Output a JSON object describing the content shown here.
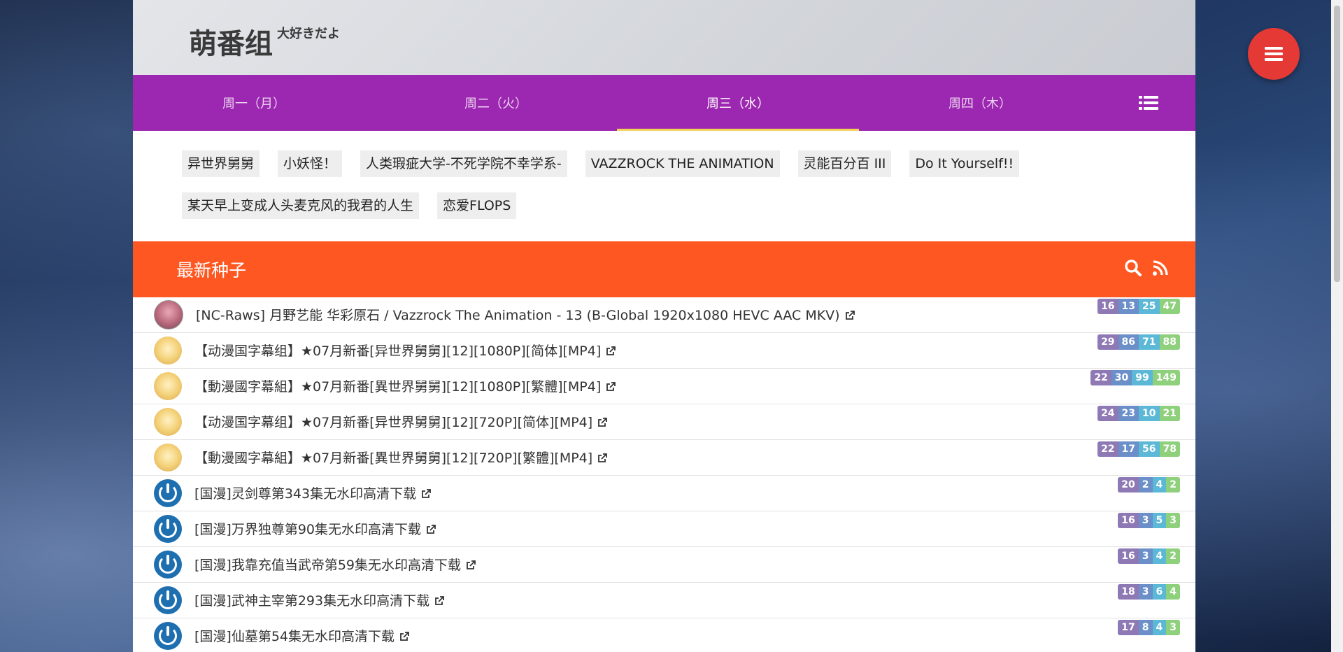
{
  "site": {
    "logo_main": "萌番组",
    "logo_sub": "大好きだよ"
  },
  "days": [
    {
      "label": "周一（月）",
      "active": false
    },
    {
      "label": "周二（火）",
      "active": false
    },
    {
      "label": "周三（水）",
      "active": true
    },
    {
      "label": "周四（木）",
      "active": false
    }
  ],
  "tags": [
    "异世界舅舅",
    "小妖怪！",
    "人类瑕疵大学-不死学院不幸学系-",
    "VAZZROCK THE ANIMATION",
    "灵能百分百 III",
    "Do It Yourself!!",
    "某天早上变成人头麦克风的我君的人生",
    "恋爱FLOPS"
  ],
  "seeds": {
    "title": "最新种子",
    "icons": [
      "search-icon",
      "rss-icon"
    ]
  },
  "torrents": [
    {
      "avatar": "nc",
      "title": "[NC-Raws] 月野艺能 华彩原石 / Vazzrock The Animation - 13 (B-Global 1920x1080 HEVC AAC MKV)",
      "stats": [
        "16",
        "13",
        "25",
        "47"
      ]
    },
    {
      "avatar": "dm",
      "title": "【动漫国字幕组】★07月新番[异世界舅舅][12][1080P][简体][MP4]",
      "stats": [
        "29",
        "86",
        "71",
        "88"
      ]
    },
    {
      "avatar": "dm",
      "title": "【動漫國字幕組】★07月新番[異世界舅舅][12][1080P][繁體][MP4]",
      "stats": [
        "22",
        "30",
        "99",
        "149"
      ]
    },
    {
      "avatar": "dm",
      "title": "【动漫国字幕组】★07月新番[异世界舅舅][12][720P][简体][MP4]",
      "stats": [
        "24",
        "23",
        "10",
        "21"
      ]
    },
    {
      "avatar": "dm",
      "title": "【動漫國字幕組】★07月新番[異世界舅舅][12][720P][繁體][MP4]",
      "stats": [
        "22",
        "17",
        "56",
        "78"
      ]
    },
    {
      "avatar": "gm",
      "title": "[国漫]灵剑尊第343集无水印高清下载",
      "stats": [
        "20",
        "2",
        "4",
        "2"
      ]
    },
    {
      "avatar": "gm",
      "title": "[国漫]万界独尊第90集无水印高清下载",
      "stats": [
        "16",
        "3",
        "5",
        "3"
      ]
    },
    {
      "avatar": "gm",
      "title": "[国漫]我靠充值当武帝第59集无水印高清下载",
      "stats": [
        "16",
        "3",
        "4",
        "2"
      ]
    },
    {
      "avatar": "gm",
      "title": "[国漫]武神主宰第293集无水印高清下载",
      "stats": [
        "18",
        "3",
        "6",
        "4"
      ]
    },
    {
      "avatar": "gm",
      "title": "[国漫]仙墓第54集无水印高清下载",
      "stats": [
        "17",
        "8",
        "4",
        "3"
      ]
    }
  ],
  "colors": {
    "daynav": "#9c27b0",
    "seedbar": "#ff5722",
    "fab": "#e53935"
  }
}
